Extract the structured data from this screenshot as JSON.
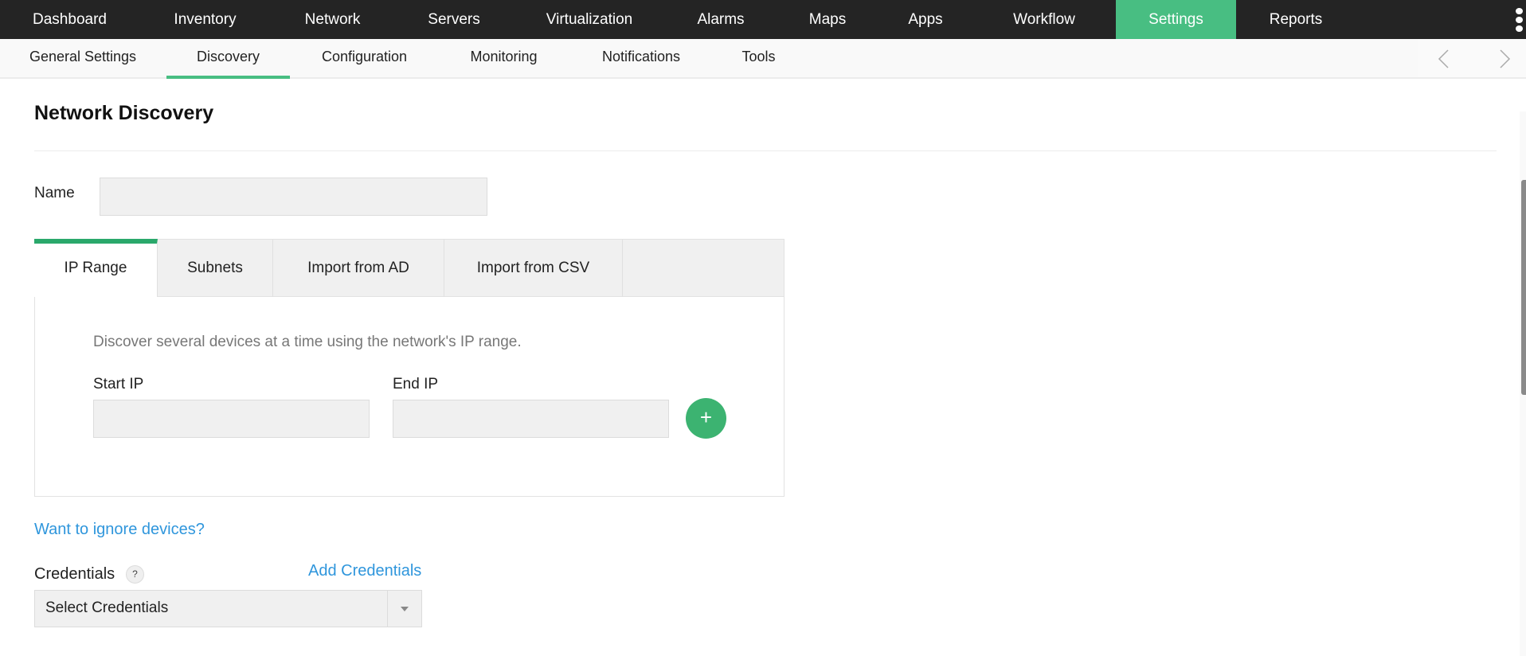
{
  "topnav": {
    "items": [
      {
        "label": "Dashboard"
      },
      {
        "label": "Inventory"
      },
      {
        "label": "Network"
      },
      {
        "label": "Servers"
      },
      {
        "label": "Virtualization"
      },
      {
        "label": "Alarms"
      },
      {
        "label": "Maps"
      },
      {
        "label": "Apps"
      },
      {
        "label": "Workflow"
      },
      {
        "label": "Settings",
        "active": true
      },
      {
        "label": "Reports"
      }
    ],
    "more_icon": "more-vertical-icon",
    "accent": "#48be82"
  },
  "subnav": {
    "items": [
      {
        "label": "General Settings"
      },
      {
        "label": "Discovery",
        "active": true
      },
      {
        "label": "Configuration"
      },
      {
        "label": "Monitoring"
      },
      {
        "label": "Notifications"
      },
      {
        "label": "Tools"
      }
    ],
    "prev_icon": "chevron-left-icon",
    "next_icon": "chevron-right-icon"
  },
  "page": {
    "title": "Network Discovery",
    "name_label": "Name",
    "name_value": "",
    "tabs": [
      {
        "label": "IP Range",
        "active": true
      },
      {
        "label": "Subnets"
      },
      {
        "label": "Import from AD"
      },
      {
        "label": "Import from CSV"
      }
    ],
    "ip_range": {
      "description": "Discover several devices at a time using the network's IP range.",
      "start_label": "Start IP",
      "start_value": "",
      "end_label": "End IP",
      "end_value": "",
      "add_symbol": "+"
    },
    "ignore_link": "Want to ignore devices?",
    "credentials": {
      "label": "Credentials",
      "help_symbol": "?",
      "add_link": "Add Credentials",
      "selected": "Select Credentials"
    }
  }
}
